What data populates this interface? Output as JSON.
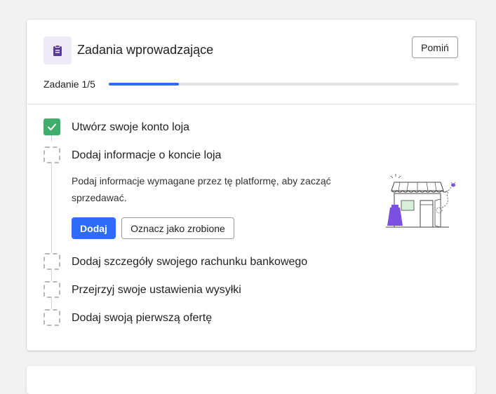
{
  "header": {
    "title": "Zadania wprowadzające",
    "icon": "clipboard-icon",
    "icon_color": "#5a3d9a",
    "skip_label": "Pomiń"
  },
  "progress": {
    "label": "Zadanie 1/5",
    "fraction": 0.2,
    "accent": "#2d6cf6"
  },
  "tasks": [
    {
      "label": "Utwórz swoje konto loja",
      "status": "done"
    },
    {
      "label": "Dodaj informacje o koncie loja",
      "status": "active",
      "description": "Podaj informacje wymagane przez tę platformę, aby zacząć sprzedawać.",
      "primary_action": "Dodaj",
      "secondary_action": "Oznacz jako zrobione",
      "illustration": "storefront-illustration"
    },
    {
      "label": "Dodaj szczegóły swojego rachunku bankowego",
      "status": "todo"
    },
    {
      "label": "Przejrzyj swoje ustawienia wysyłki",
      "status": "todo"
    },
    {
      "label": "Dodaj swoją pierwszą ofertę",
      "status": "todo"
    }
  ],
  "colors": {
    "done_check": "#3fae6a",
    "primary_button": "#2d6cf6"
  }
}
